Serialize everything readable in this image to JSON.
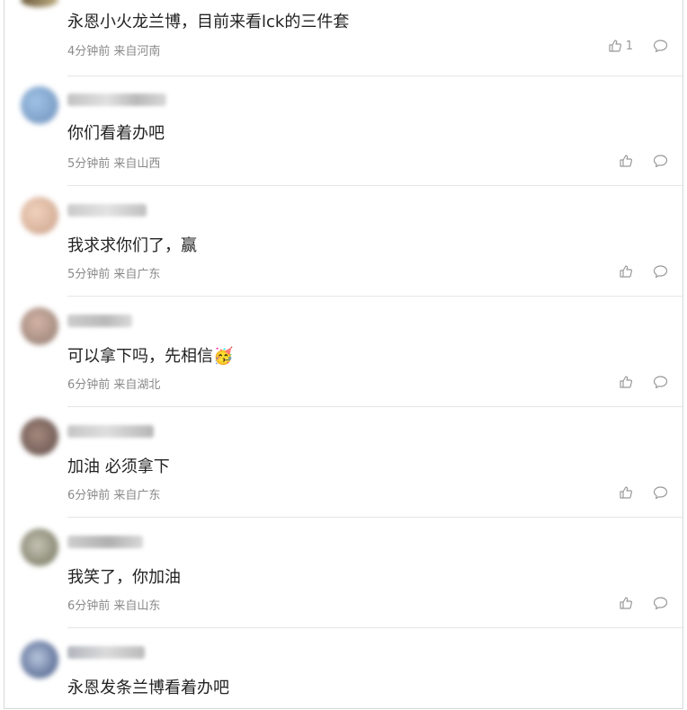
{
  "comments": [
    {
      "text": "永恩小火龙兰博，目前来看lck的三件套",
      "meta": "4分钟前 来自河南",
      "likes": "1",
      "has_avatar_row": false
    },
    {
      "text": "你们看着办吧",
      "meta": "5分钟前 来自山西",
      "likes": ""
    },
    {
      "text": "我求求你们了，赢",
      "meta": "5分钟前 来自广东",
      "likes": ""
    },
    {
      "text": "可以拿下吗，先相信",
      "emoji": "🥳",
      "meta": "6分钟前 来自湖北",
      "likes": ""
    },
    {
      "text": "加油 必须拿下",
      "meta": "6分钟前 来自广东",
      "likes": ""
    },
    {
      "text": "我笑了，你加油",
      "meta": "6分钟前 来自山东",
      "likes": ""
    },
    {
      "text": "永恩发条兰博看着办吧",
      "meta": "",
      "likes": ""
    }
  ],
  "icons": {
    "like": "thumbs-up-icon",
    "reply": "comment-bubble-icon"
  },
  "colors": {
    "meta": "#8a8a8a",
    "text": "#222222",
    "divider": "#e6e6e6"
  }
}
